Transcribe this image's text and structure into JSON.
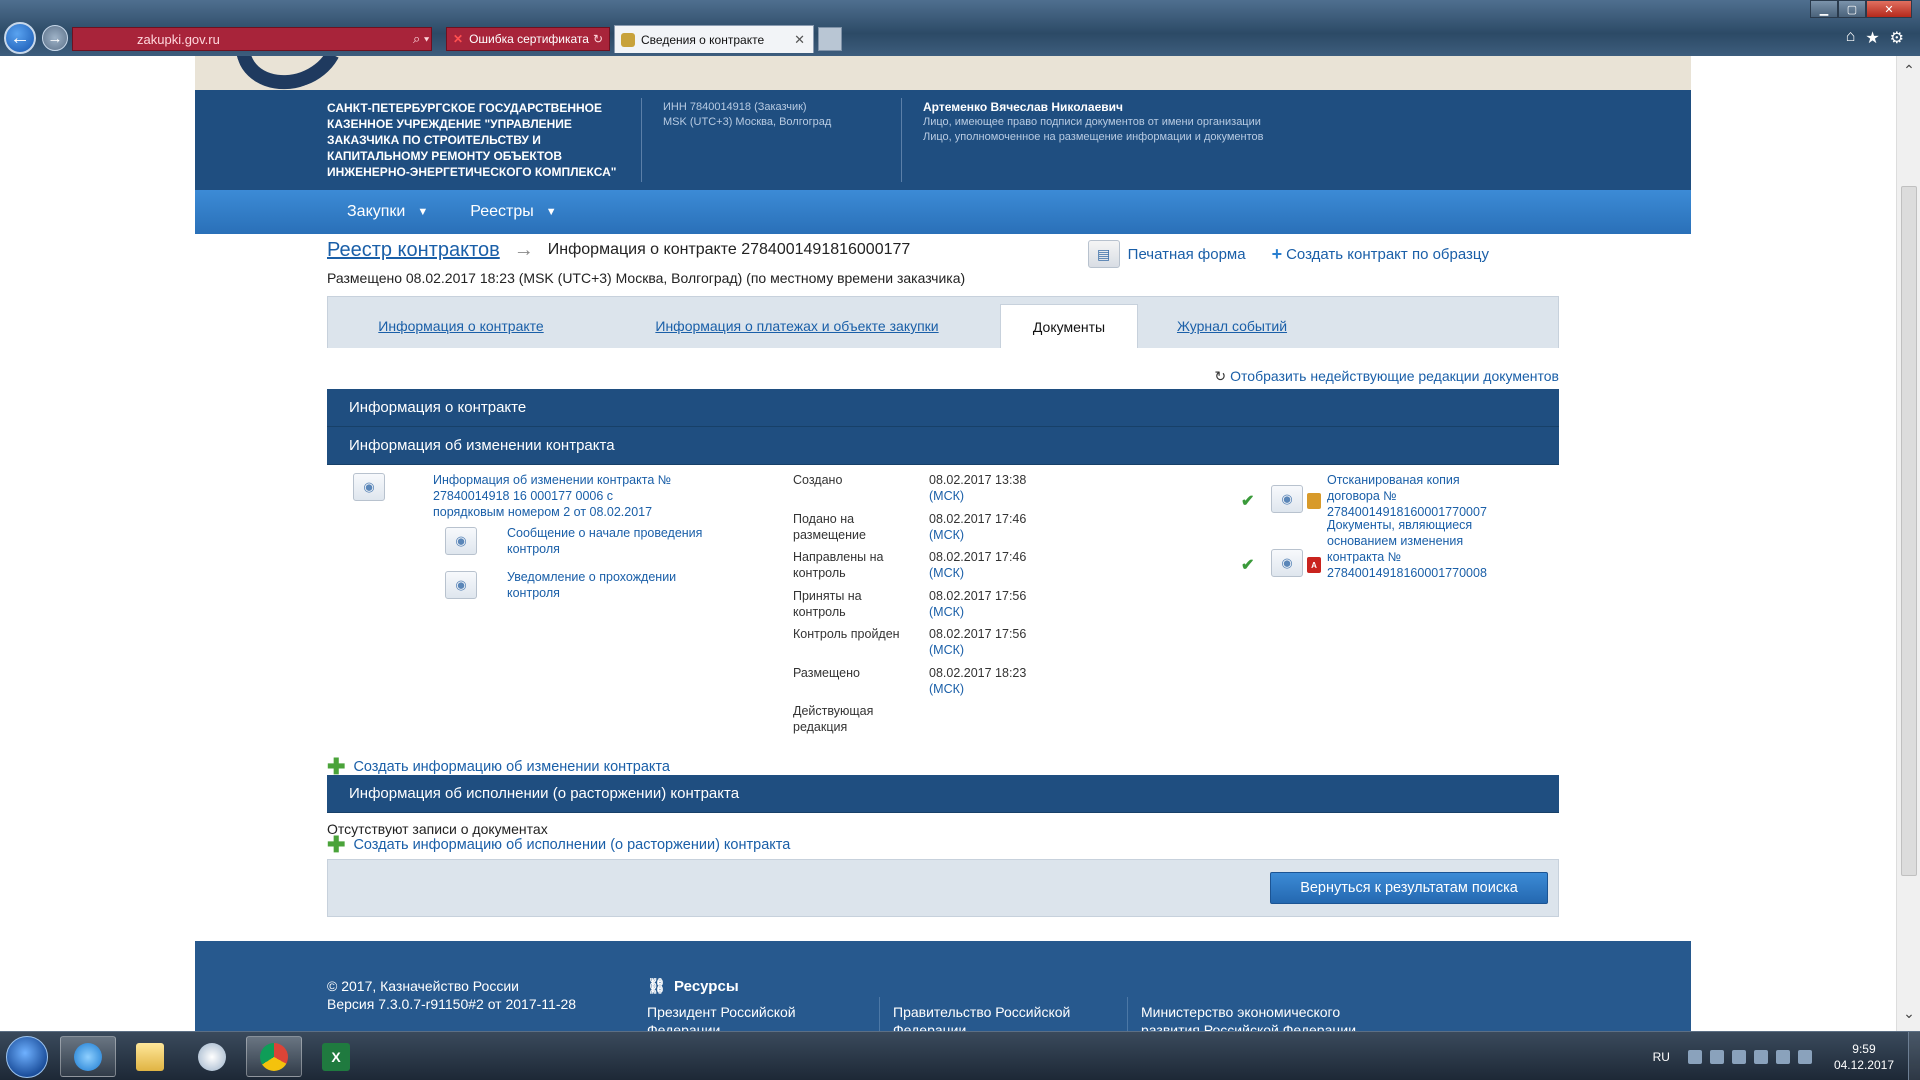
{
  "browser": {
    "address": "zakupki.gov.ru",
    "cert_tab": "Ошибка сертификата",
    "active_tab": "Сведения о контракте"
  },
  "org": {
    "name": "САНКТ-ПЕТЕРБУРГСКОЕ ГОСУДАРСТВЕННОЕ КАЗЕННОЕ УЧРЕЖДЕНИЕ \"УПРАВЛЕНИЕ ЗАКАЗЧИКА ПО СТРОИТЕЛЬСТВУ И КАПИТАЛЬНОМУ РЕМОНТУ ОБЪЕКТОВ ИНЖЕНЕРНО-ЭНЕРГЕТИЧЕСКОГО КОМПЛЕКСА\"",
    "inn": "ИНН 7840014918 (Заказчик)",
    "timezone": "MSK (UTC+3) Москва, Волгоград"
  },
  "user": {
    "name": "Артеменко Вячеслав Николаевич",
    "role1": "Лицо, имеющее право подписи документов от имени организации",
    "role2": "Лицо, уполномоченное на размещение информации и документов"
  },
  "menu": {
    "purchases": "Закупки",
    "registries": "Реестры"
  },
  "breadcrumb": {
    "link": "Реестр контрактов",
    "title": "Информация о контракте 2784001491816000177"
  },
  "actions": {
    "print": "Печатная форма",
    "create_by_sample": "Создать контракт по образцу"
  },
  "posted_text": "Размещено 08.02.2017 18:23 (MSK (UTC+3) Москва, Волгоград) (по местному времени заказчика)",
  "tabs": [
    {
      "label": "Информация о контракте"
    },
    {
      "label": "Информация о платежах и объекте закупки"
    },
    {
      "label": "Документы"
    },
    {
      "label": "Журнал событий"
    }
  ],
  "show_inactive": "Отобразить недействующие редакции документов",
  "sections": {
    "contract_info": "Информация о контракте",
    "change_info": "Информация об изменении контракта",
    "execution_info": "Информация об исполнении (о расторжении) контракта"
  },
  "change_doc": {
    "main_link": "Информация об изменении контракта № 27840014918 16 000177 0006 с порядковым номером 2 от 08.02.2017",
    "sub1": "Сообщение о начале проведения контроля",
    "sub2": "Уведомление о прохождении контроля"
  },
  "statuses": [
    {
      "label": "Создано",
      "date": "08.02.2017 13:38",
      "tz": "(МСК)"
    },
    {
      "label": "Подано на размещение",
      "date": "08.02.2017 17:46",
      "tz": "(МСК)"
    },
    {
      "label": "Направлены на контроль",
      "date": "08.02.2017 17:46",
      "tz": "(МСК)"
    },
    {
      "label": "Приняты на контроль",
      "date": "08.02.2017 17:56",
      "tz": "(МСК)"
    },
    {
      "label": "Контроль пройден",
      "date": "08.02.2017 17:56",
      "tz": "(МСК)"
    },
    {
      "label": "Размещено",
      "date": "08.02.2017 18:23",
      "tz": "(МСК)"
    },
    {
      "label": "Действующая редакция",
      "date": "",
      "tz": ""
    }
  ],
  "attachments": {
    "a1": "Отсканированая копия договора № 27840014918160001770007",
    "a2": "Документы, являющиеся основанием изменения контракта № 27840014918160001770008"
  },
  "create_change": "Создать информацию об изменении контракта",
  "no_records": "Отсутствуют записи о документах",
  "create_execution": "Создать информацию об исполнении (о расторжении) контракта",
  "back_button": "Вернуться к результатам поиска",
  "footer": {
    "copyright": "© 2017, Казначейство России",
    "version": "Версия 7.3.0.7-r91150#2 от 2017-11-28",
    "resources": "Ресурсы",
    "links": [
      "Президент Российской Федерации",
      "Правительство Российской Федерации",
      "Министерство экономического развития Российской Федерации"
    ]
  },
  "taskbar": {
    "lang": "RU",
    "time": "9:59",
    "date": "04.12.2017"
  }
}
